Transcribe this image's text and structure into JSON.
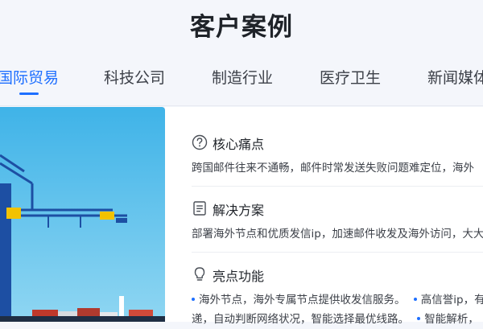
{
  "page": {
    "title": "客户案例"
  },
  "tabs": [
    {
      "label": "国际贸易",
      "active": true
    },
    {
      "label": "科技公司",
      "active": false
    },
    {
      "label": "制造行业",
      "active": false
    },
    {
      "label": "医疗卫生",
      "active": false
    },
    {
      "label": "新闻媒体",
      "active": false
    }
  ],
  "sections": {
    "pain": {
      "icon": "question-circle-icon",
      "title": "核心痛点",
      "text": "跨国邮件往来不通畅，邮件时常发送失败问题难定位，海外"
    },
    "solution": {
      "icon": "document-icon",
      "title": "解决方案",
      "text": "部署海外节点和优质发信ip，加速邮件收发及海外访问，大大"
    },
    "highlights": {
      "icon": "lightbulb-icon",
      "title": "亮点功能",
      "line1": {
        "a": "海外节点，海外专属节点提供收发信服务。",
        "b": "高信誉ip，有"
      },
      "line2": {
        "a": "递，自动判断网络状况，智能选择最优线路。",
        "b": "智能解析，"
      }
    }
  },
  "colors": {
    "accent": "#1e6fff",
    "sky": "#5cc0ea",
    "crane": "#1d4fa3"
  }
}
